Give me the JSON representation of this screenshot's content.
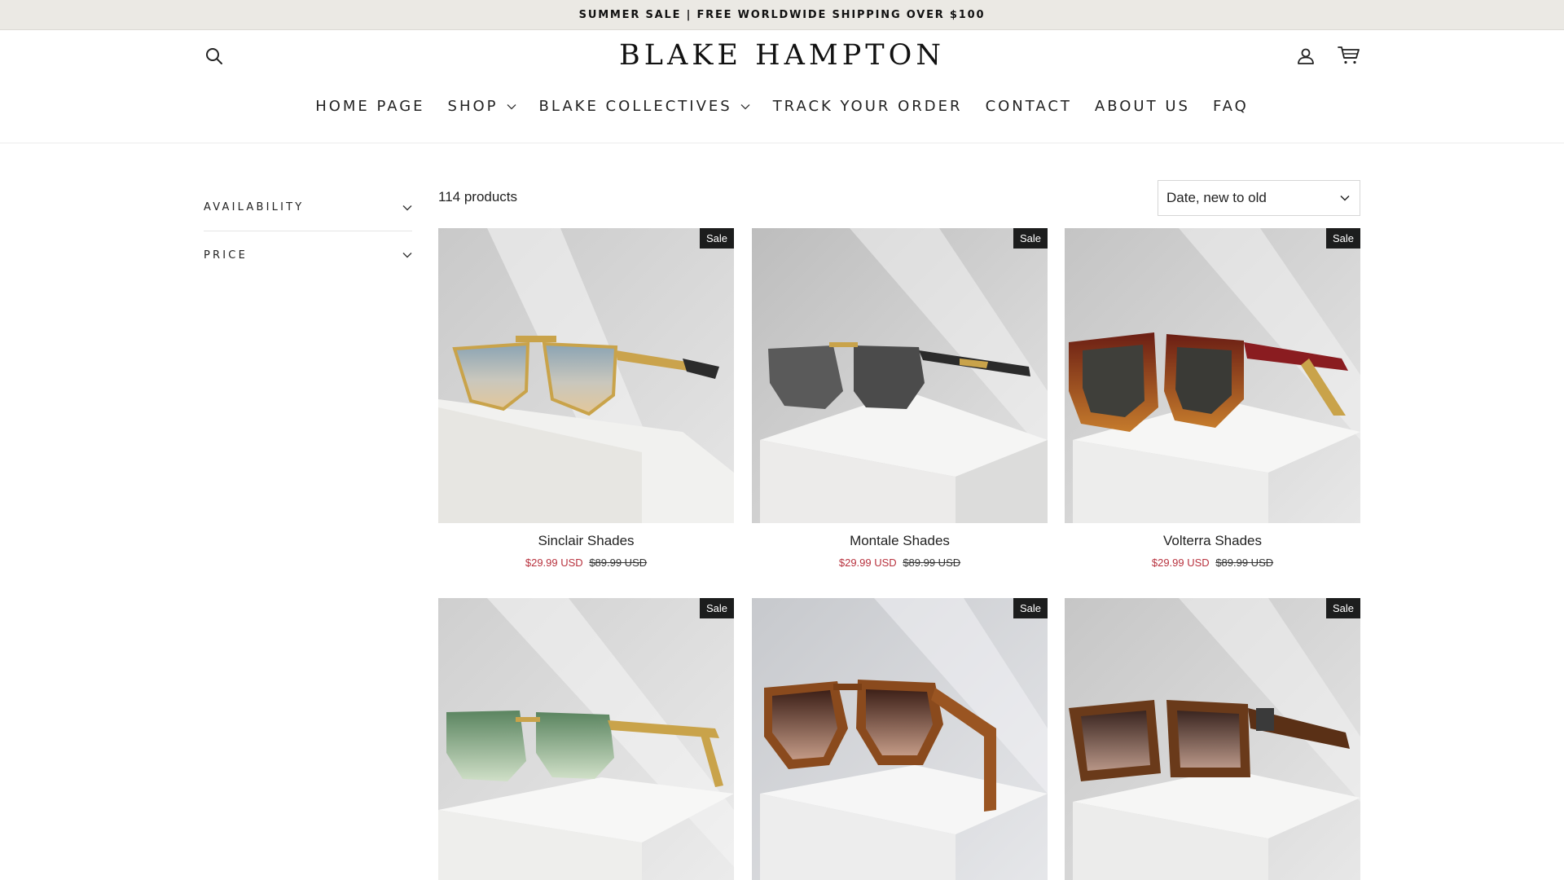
{
  "announcement": {
    "text": "SUMMER SALE | FREE WORLDWIDE SHIPPING OVER $100"
  },
  "header": {
    "logo": "BLAKE HAMPTON",
    "icons": {
      "search": "search-icon",
      "account": "account-icon",
      "cart": "cart-icon"
    }
  },
  "nav": {
    "items": [
      {
        "label": "HOME PAGE",
        "has_dropdown": false
      },
      {
        "label": "SHOP",
        "has_dropdown": true
      },
      {
        "label": "BLAKE COLLECTIVES",
        "has_dropdown": true
      },
      {
        "label": "TRACK YOUR ORDER",
        "has_dropdown": false
      },
      {
        "label": "CONTACT",
        "has_dropdown": false
      },
      {
        "label": "ABOUT US",
        "has_dropdown": false
      },
      {
        "label": "FAQ",
        "has_dropdown": false
      }
    ]
  },
  "filters": [
    {
      "label": "AVAILABILITY"
    },
    {
      "label": "PRICE"
    }
  ],
  "collection": {
    "count": "114 products",
    "sort": {
      "selected": "Date, new to old"
    }
  },
  "products": [
    {
      "title": "Sinclair Shades",
      "badge": "Sale",
      "sale_price": "$29.99 USD",
      "original_price": "$89.99 USD"
    },
    {
      "title": "Montale Shades",
      "badge": "Sale",
      "sale_price": "$29.99 USD",
      "original_price": "$89.99 USD"
    },
    {
      "title": "Volterra Shades",
      "badge": "Sale",
      "sale_price": "$29.99 USD",
      "original_price": "$89.99 USD"
    },
    {
      "title": "",
      "badge": "Sale",
      "sale_price": "",
      "original_price": ""
    },
    {
      "title": "",
      "badge": "Sale",
      "sale_price": "",
      "original_price": ""
    },
    {
      "title": "",
      "badge": "Sale",
      "sale_price": "",
      "original_price": ""
    }
  ],
  "colors": {
    "announcement_bg": "#ebe9e4",
    "sale_price": "#b8323e",
    "badge_bg": "#1c1d1d"
  }
}
